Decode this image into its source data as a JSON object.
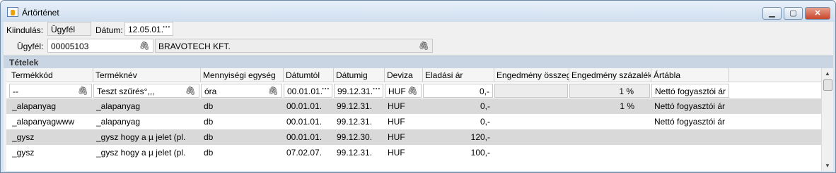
{
  "window": {
    "title": "Ártörténet",
    "min_glyph": "▁",
    "max_glyph": "▢",
    "close_glyph": "✕"
  },
  "form": {
    "kiindulas_label": "Kiindulás:",
    "kiindulas_value": "Ügyfél",
    "datum_label": "Dátum:",
    "datum_value": "12.05.01.",
    "ugyfel_label": "Ügyfél:",
    "ugyfel_code": "00005103",
    "ugyfel_name": "BRAVOTECH KFT."
  },
  "section": {
    "title": "Tételek"
  },
  "grid": {
    "headers": [
      "Termékkód",
      "Terméknév",
      "Mennyiségi egység",
      "Dátumtól",
      "Dátumig",
      "Deviza",
      "Eladási ár",
      "Engedmény összeg",
      "Engedmény százalék",
      "Ártábla"
    ],
    "filter": {
      "termekkod": "--",
      "termeknev": "Teszt szűrés°,,,",
      "egyseg": "óra",
      "datumtol": "00.01.01.",
      "datumig": "99.12.31.",
      "deviza": "HUF",
      "eladasi_ar": "0,-",
      "engedmeny_osszeg": "",
      "engedmeny_szazalek": "1 %",
      "artabla": "Nettó fogyasztói ár"
    },
    "rows": [
      {
        "termekkod": "_alapanyag",
        "termeknev": "_alapanyag",
        "egyseg": "db",
        "datumtol": "00.01.01.",
        "datumig": "99.12.31.",
        "deviza": "HUF",
        "eladasi_ar": "0,-",
        "engedmeny_osszeg": "",
        "engedmeny_szazalek": "1 %",
        "artabla": "Nettó fogyasztói ár"
      },
      {
        "termekkod": "_alapanyagwww",
        "termeknev": "_alapanyag",
        "egyseg": "db",
        "datumtol": "00.01.01.",
        "datumig": "99.12.31.",
        "deviza": "HUF",
        "eladasi_ar": "0,-",
        "engedmeny_osszeg": "",
        "engedmeny_szazalek": "",
        "artabla": "Nettó fogyasztói ár"
      },
      {
        "termekkod": "_gysz",
        "termeknev": "_gysz hogy a µ jelet (pl.",
        "egyseg": "db",
        "datumtol": "00.01.01.",
        "datumig": "99.12.30.",
        "deviza": "HUF",
        "eladasi_ar": "120,-",
        "engedmeny_osszeg": "",
        "engedmeny_szazalek": "",
        "artabla": ""
      },
      {
        "termekkod": "_gysz",
        "termeknev": "_gysz hogy a µ jelet (pl.",
        "egyseg": "db",
        "datumtol": "07.02.07.",
        "datumig": "99.12.31.",
        "deviza": "HUF",
        "eladasi_ar": "100,-",
        "engedmeny_osszeg": "",
        "engedmeny_szazalek": "",
        "artabla": ""
      }
    ]
  },
  "icons": {
    "attach": "paperclip-icon",
    "ellipsis": "ellipsis-icon"
  },
  "colors": {
    "section_bar": "#c9d5e2",
    "row_alt": "#d9d9d9",
    "close_button": "#c9462c"
  }
}
